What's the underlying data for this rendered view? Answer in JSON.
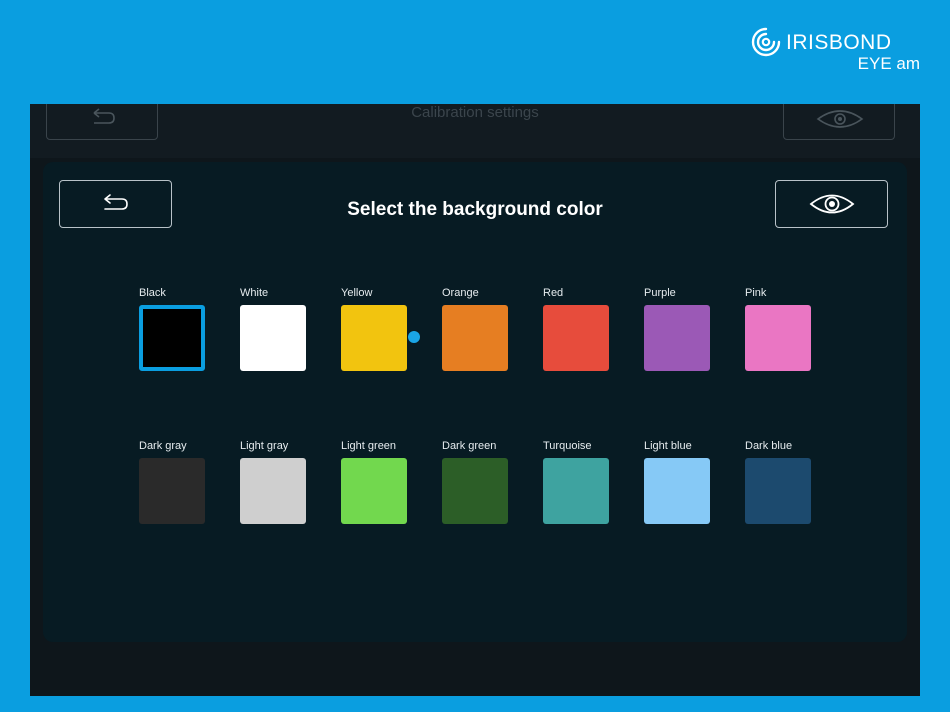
{
  "brand": {
    "name": "IRISBOND",
    "sub": "EYE am"
  },
  "background_screen": {
    "title": "Calibration settings"
  },
  "dialog": {
    "title": "Select the background color"
  },
  "selected_color": "Black",
  "colors": [
    {
      "label": "Black",
      "hex": "#000000"
    },
    {
      "label": "White",
      "hex": "#ffffff"
    },
    {
      "label": "Yellow",
      "hex": "#f2c40f"
    },
    {
      "label": "Orange",
      "hex": "#e67e22"
    },
    {
      "label": "Red",
      "hex": "#e74c3c"
    },
    {
      "label": "Purple",
      "hex": "#9b59b6"
    },
    {
      "label": "Pink",
      "hex": "#ea76c3"
    },
    {
      "label": "Dark gray",
      "hex": "#2a2a2a"
    },
    {
      "label": "Light gray",
      "hex": "#cfcfcf"
    },
    {
      "label": "Light green",
      "hex": "#72d84e"
    },
    {
      "label": "Dark green",
      "hex": "#2c5e27"
    },
    {
      "label": "Turquoise",
      "hex": "#3ea3a0"
    },
    {
      "label": "Light blue",
      "hex": "#86c9f6"
    },
    {
      "label": "Dark blue",
      "hex": "#1c4a6e"
    }
  ],
  "accent_color": "#0a9ee0"
}
